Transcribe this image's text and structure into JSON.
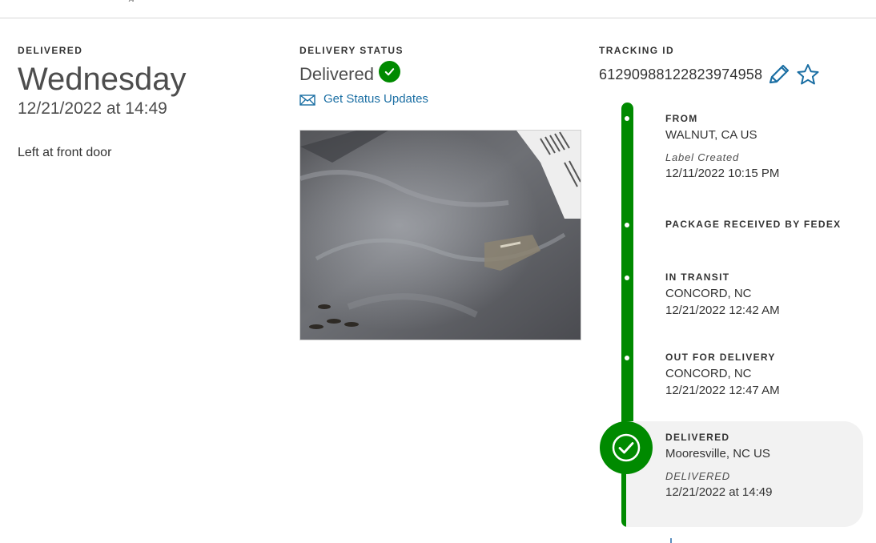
{
  "header": {
    "clipped_text": "g"
  },
  "summary": {
    "label": "DELIVERED",
    "day": "Wednesday",
    "datetime": "12/21/2022 at 14:49",
    "note": "Left at front door"
  },
  "status": {
    "label": "DELIVERY STATUS",
    "value": "Delivered",
    "updates_link": "Get Status Updates",
    "photo_icon": "package-photo"
  },
  "tracking": {
    "label": "TRACKING ID",
    "number": "612909881228239749​58",
    "edit_icon": "pencil-icon",
    "favorite_icon": "star-icon"
  },
  "timeline": [
    {
      "title": "FROM",
      "location": "WALNUT, CA US",
      "detail": "Label Created",
      "time": "12/11/2022 10:15 PM"
    },
    {
      "title": "PACKAGE RECEIVED BY FEDEX",
      "location": "",
      "detail": "",
      "time": ""
    },
    {
      "title": "IN TRANSIT",
      "location": "CONCORD, NC",
      "detail": "",
      "time": "12/21/2022 12:42 AM"
    },
    {
      "title": "OUT FOR DELIVERY",
      "location": "CONCORD, NC",
      "detail": "",
      "time": "12/21/2022 12:47 AM"
    },
    {
      "title": "DELIVERED",
      "location": "Mooresville, NC US",
      "detail": "DELIVERED",
      "time": "12/21/2022 at 14:49"
    }
  ],
  "colors": {
    "accent_green": "#008a00",
    "link_blue": "#1a6ea3",
    "card_gray": "#f2f2f2"
  }
}
